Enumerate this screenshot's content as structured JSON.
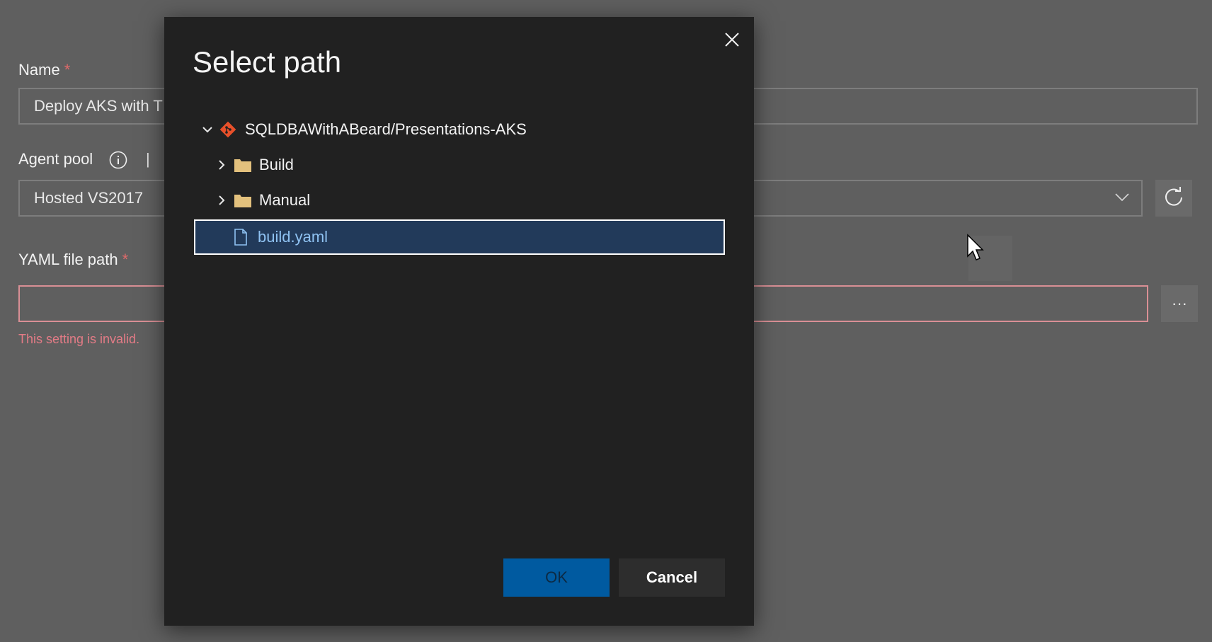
{
  "form": {
    "name_label": "Name",
    "required_mark": "*",
    "name_value": "Deploy AKS with T",
    "agent_pool_label": "Agent pool",
    "agent_pool_separator": "|",
    "agent_pool_value": "Hosted VS2017",
    "yaml_label": "YAML file path",
    "yaml_value": "",
    "yaml_error": "This setting is invalid.",
    "browse_label": "···"
  },
  "dialog": {
    "title": "Select path",
    "repo": "SQLDBAWithABeard/Presentations-AKS",
    "items": [
      {
        "label": "Build",
        "type": "folder"
      },
      {
        "label": "Manual",
        "type": "folder"
      },
      {
        "label": "build.yaml",
        "type": "file",
        "selected": true
      }
    ],
    "ok_label": "OK",
    "cancel_label": "Cancel"
  },
  "colors": {
    "dialog_bg": "#212121",
    "selected_bg": "#223a5a",
    "ok_bg": "#005aa0",
    "error": "#e37b86",
    "git_icon": "#e8502a",
    "folder": "#e3c17d"
  }
}
